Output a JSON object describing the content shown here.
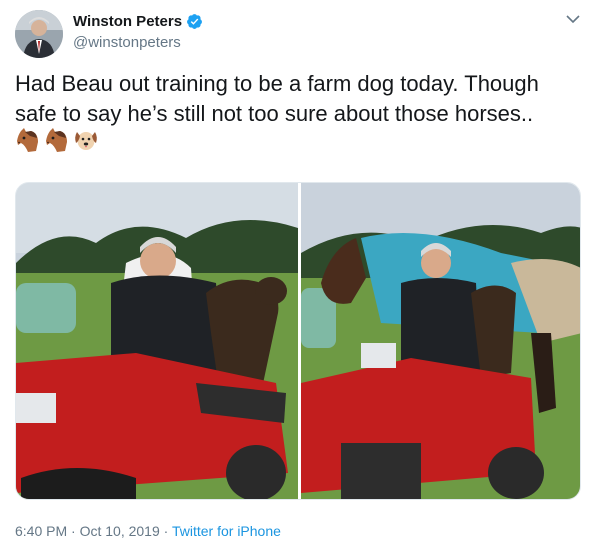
{
  "author": {
    "display_name": "Winston Peters",
    "handle": "@winstonpeters",
    "verified": true
  },
  "tweet": {
    "lines": [
      "Had Beau out training to be a farm dog today. Though",
      "safe to say he’s still not too sure about those horses.."
    ],
    "emojis": [
      "horse-face-emoji",
      "horse-face-emoji",
      "dog-face-emoji"
    ],
    "media": [
      {
        "description": "photo-man-on-red-quad-bike-with-dog"
      },
      {
        "description": "photo-man-on-red-quad-bike-with-dog-and-horse"
      }
    ]
  },
  "meta": {
    "time": "6:40 PM",
    "separator": " · ",
    "date": "Oct 10, 2019",
    "source": "Twitter for iPhone"
  },
  "colors": {
    "verified_blue": "#1da1f2",
    "link_blue": "#1b95e0",
    "muted_text": "#657786"
  }
}
